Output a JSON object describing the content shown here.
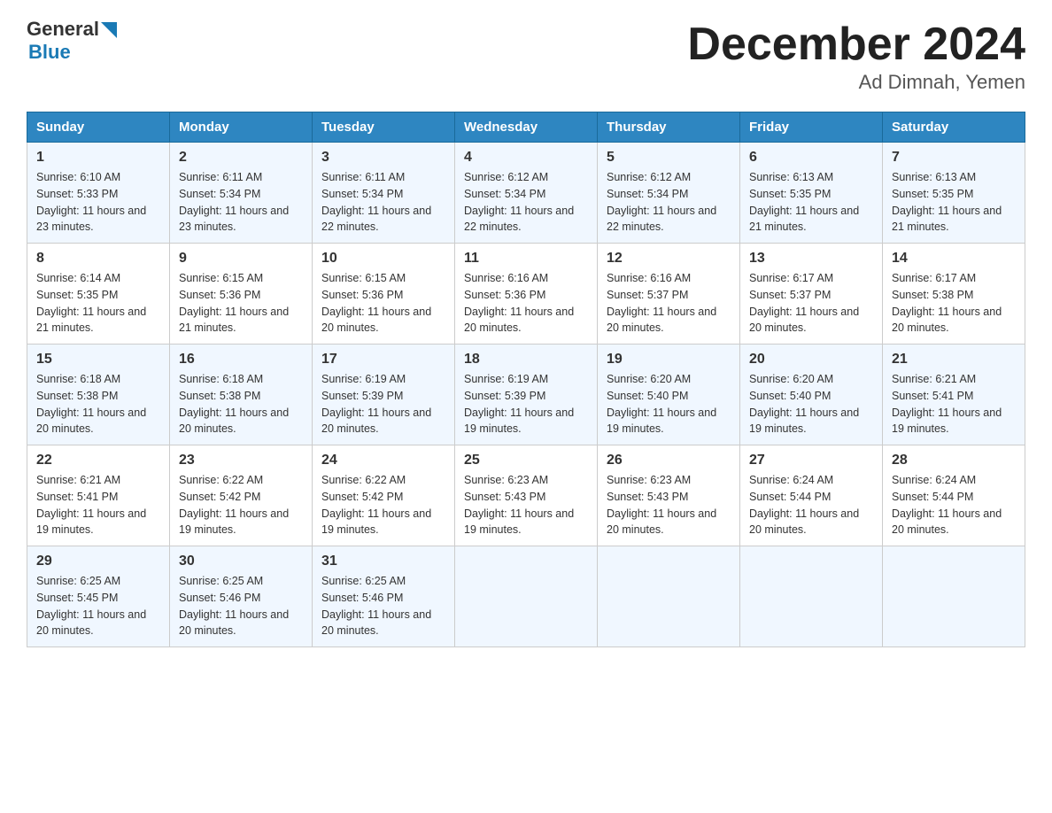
{
  "header": {
    "logo_general": "General",
    "logo_blue": "Blue",
    "month_title": "December 2024",
    "location": "Ad Dimnah, Yemen"
  },
  "weekdays": [
    "Sunday",
    "Monday",
    "Tuesday",
    "Wednesday",
    "Thursday",
    "Friday",
    "Saturday"
  ],
  "weeks": [
    [
      {
        "day": "1",
        "sunrise": "6:10 AM",
        "sunset": "5:33 PM",
        "daylight": "11 hours and 23 minutes."
      },
      {
        "day": "2",
        "sunrise": "6:11 AM",
        "sunset": "5:34 PM",
        "daylight": "11 hours and 23 minutes."
      },
      {
        "day": "3",
        "sunrise": "6:11 AM",
        "sunset": "5:34 PM",
        "daylight": "11 hours and 22 minutes."
      },
      {
        "day": "4",
        "sunrise": "6:12 AM",
        "sunset": "5:34 PM",
        "daylight": "11 hours and 22 minutes."
      },
      {
        "day": "5",
        "sunrise": "6:12 AM",
        "sunset": "5:34 PM",
        "daylight": "11 hours and 22 minutes."
      },
      {
        "day": "6",
        "sunrise": "6:13 AM",
        "sunset": "5:35 PM",
        "daylight": "11 hours and 21 minutes."
      },
      {
        "day": "7",
        "sunrise": "6:13 AM",
        "sunset": "5:35 PM",
        "daylight": "11 hours and 21 minutes."
      }
    ],
    [
      {
        "day": "8",
        "sunrise": "6:14 AM",
        "sunset": "5:35 PM",
        "daylight": "11 hours and 21 minutes."
      },
      {
        "day": "9",
        "sunrise": "6:15 AM",
        "sunset": "5:36 PM",
        "daylight": "11 hours and 21 minutes."
      },
      {
        "day": "10",
        "sunrise": "6:15 AM",
        "sunset": "5:36 PM",
        "daylight": "11 hours and 20 minutes."
      },
      {
        "day": "11",
        "sunrise": "6:16 AM",
        "sunset": "5:36 PM",
        "daylight": "11 hours and 20 minutes."
      },
      {
        "day": "12",
        "sunrise": "6:16 AM",
        "sunset": "5:37 PM",
        "daylight": "11 hours and 20 minutes."
      },
      {
        "day": "13",
        "sunrise": "6:17 AM",
        "sunset": "5:37 PM",
        "daylight": "11 hours and 20 minutes."
      },
      {
        "day": "14",
        "sunrise": "6:17 AM",
        "sunset": "5:38 PM",
        "daylight": "11 hours and 20 minutes."
      }
    ],
    [
      {
        "day": "15",
        "sunrise": "6:18 AM",
        "sunset": "5:38 PM",
        "daylight": "11 hours and 20 minutes."
      },
      {
        "day": "16",
        "sunrise": "6:18 AM",
        "sunset": "5:38 PM",
        "daylight": "11 hours and 20 minutes."
      },
      {
        "day": "17",
        "sunrise": "6:19 AM",
        "sunset": "5:39 PM",
        "daylight": "11 hours and 20 minutes."
      },
      {
        "day": "18",
        "sunrise": "6:19 AM",
        "sunset": "5:39 PM",
        "daylight": "11 hours and 19 minutes."
      },
      {
        "day": "19",
        "sunrise": "6:20 AM",
        "sunset": "5:40 PM",
        "daylight": "11 hours and 19 minutes."
      },
      {
        "day": "20",
        "sunrise": "6:20 AM",
        "sunset": "5:40 PM",
        "daylight": "11 hours and 19 minutes."
      },
      {
        "day": "21",
        "sunrise": "6:21 AM",
        "sunset": "5:41 PM",
        "daylight": "11 hours and 19 minutes."
      }
    ],
    [
      {
        "day": "22",
        "sunrise": "6:21 AM",
        "sunset": "5:41 PM",
        "daylight": "11 hours and 19 minutes."
      },
      {
        "day": "23",
        "sunrise": "6:22 AM",
        "sunset": "5:42 PM",
        "daylight": "11 hours and 19 minutes."
      },
      {
        "day": "24",
        "sunrise": "6:22 AM",
        "sunset": "5:42 PM",
        "daylight": "11 hours and 19 minutes."
      },
      {
        "day": "25",
        "sunrise": "6:23 AM",
        "sunset": "5:43 PM",
        "daylight": "11 hours and 19 minutes."
      },
      {
        "day": "26",
        "sunrise": "6:23 AM",
        "sunset": "5:43 PM",
        "daylight": "11 hours and 20 minutes."
      },
      {
        "day": "27",
        "sunrise": "6:24 AM",
        "sunset": "5:44 PM",
        "daylight": "11 hours and 20 minutes."
      },
      {
        "day": "28",
        "sunrise": "6:24 AM",
        "sunset": "5:44 PM",
        "daylight": "11 hours and 20 minutes."
      }
    ],
    [
      {
        "day": "29",
        "sunrise": "6:25 AM",
        "sunset": "5:45 PM",
        "daylight": "11 hours and 20 minutes."
      },
      {
        "day": "30",
        "sunrise": "6:25 AM",
        "sunset": "5:46 PM",
        "daylight": "11 hours and 20 minutes."
      },
      {
        "day": "31",
        "sunrise": "6:25 AM",
        "sunset": "5:46 PM",
        "daylight": "11 hours and 20 minutes."
      },
      null,
      null,
      null,
      null
    ]
  ]
}
